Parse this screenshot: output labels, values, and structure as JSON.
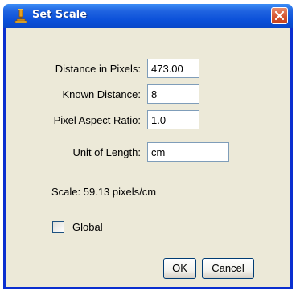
{
  "window": {
    "title": "Set Scale",
    "icon": "microscope-icon",
    "close_icon": "close-icon"
  },
  "form": {
    "distance_in_pixels": {
      "label": "Distance in Pixels:",
      "value": "473.00"
    },
    "known_distance": {
      "label": "Known Distance:",
      "value": "8"
    },
    "pixel_aspect_ratio": {
      "label": "Pixel Aspect Ratio:",
      "value": "1.0"
    },
    "unit_of_length": {
      "label": "Unit of Length:",
      "value": "cm"
    }
  },
  "scale_text": "Scale: 59.13 pixels/cm",
  "global": {
    "label": "Global",
    "checked": false
  },
  "buttons": {
    "ok": "OK",
    "cancel": "Cancel"
  },
  "colors": {
    "title_bar": "#0a4fd8",
    "close_button": "#d5532e",
    "client_background": "#ece9d8"
  }
}
